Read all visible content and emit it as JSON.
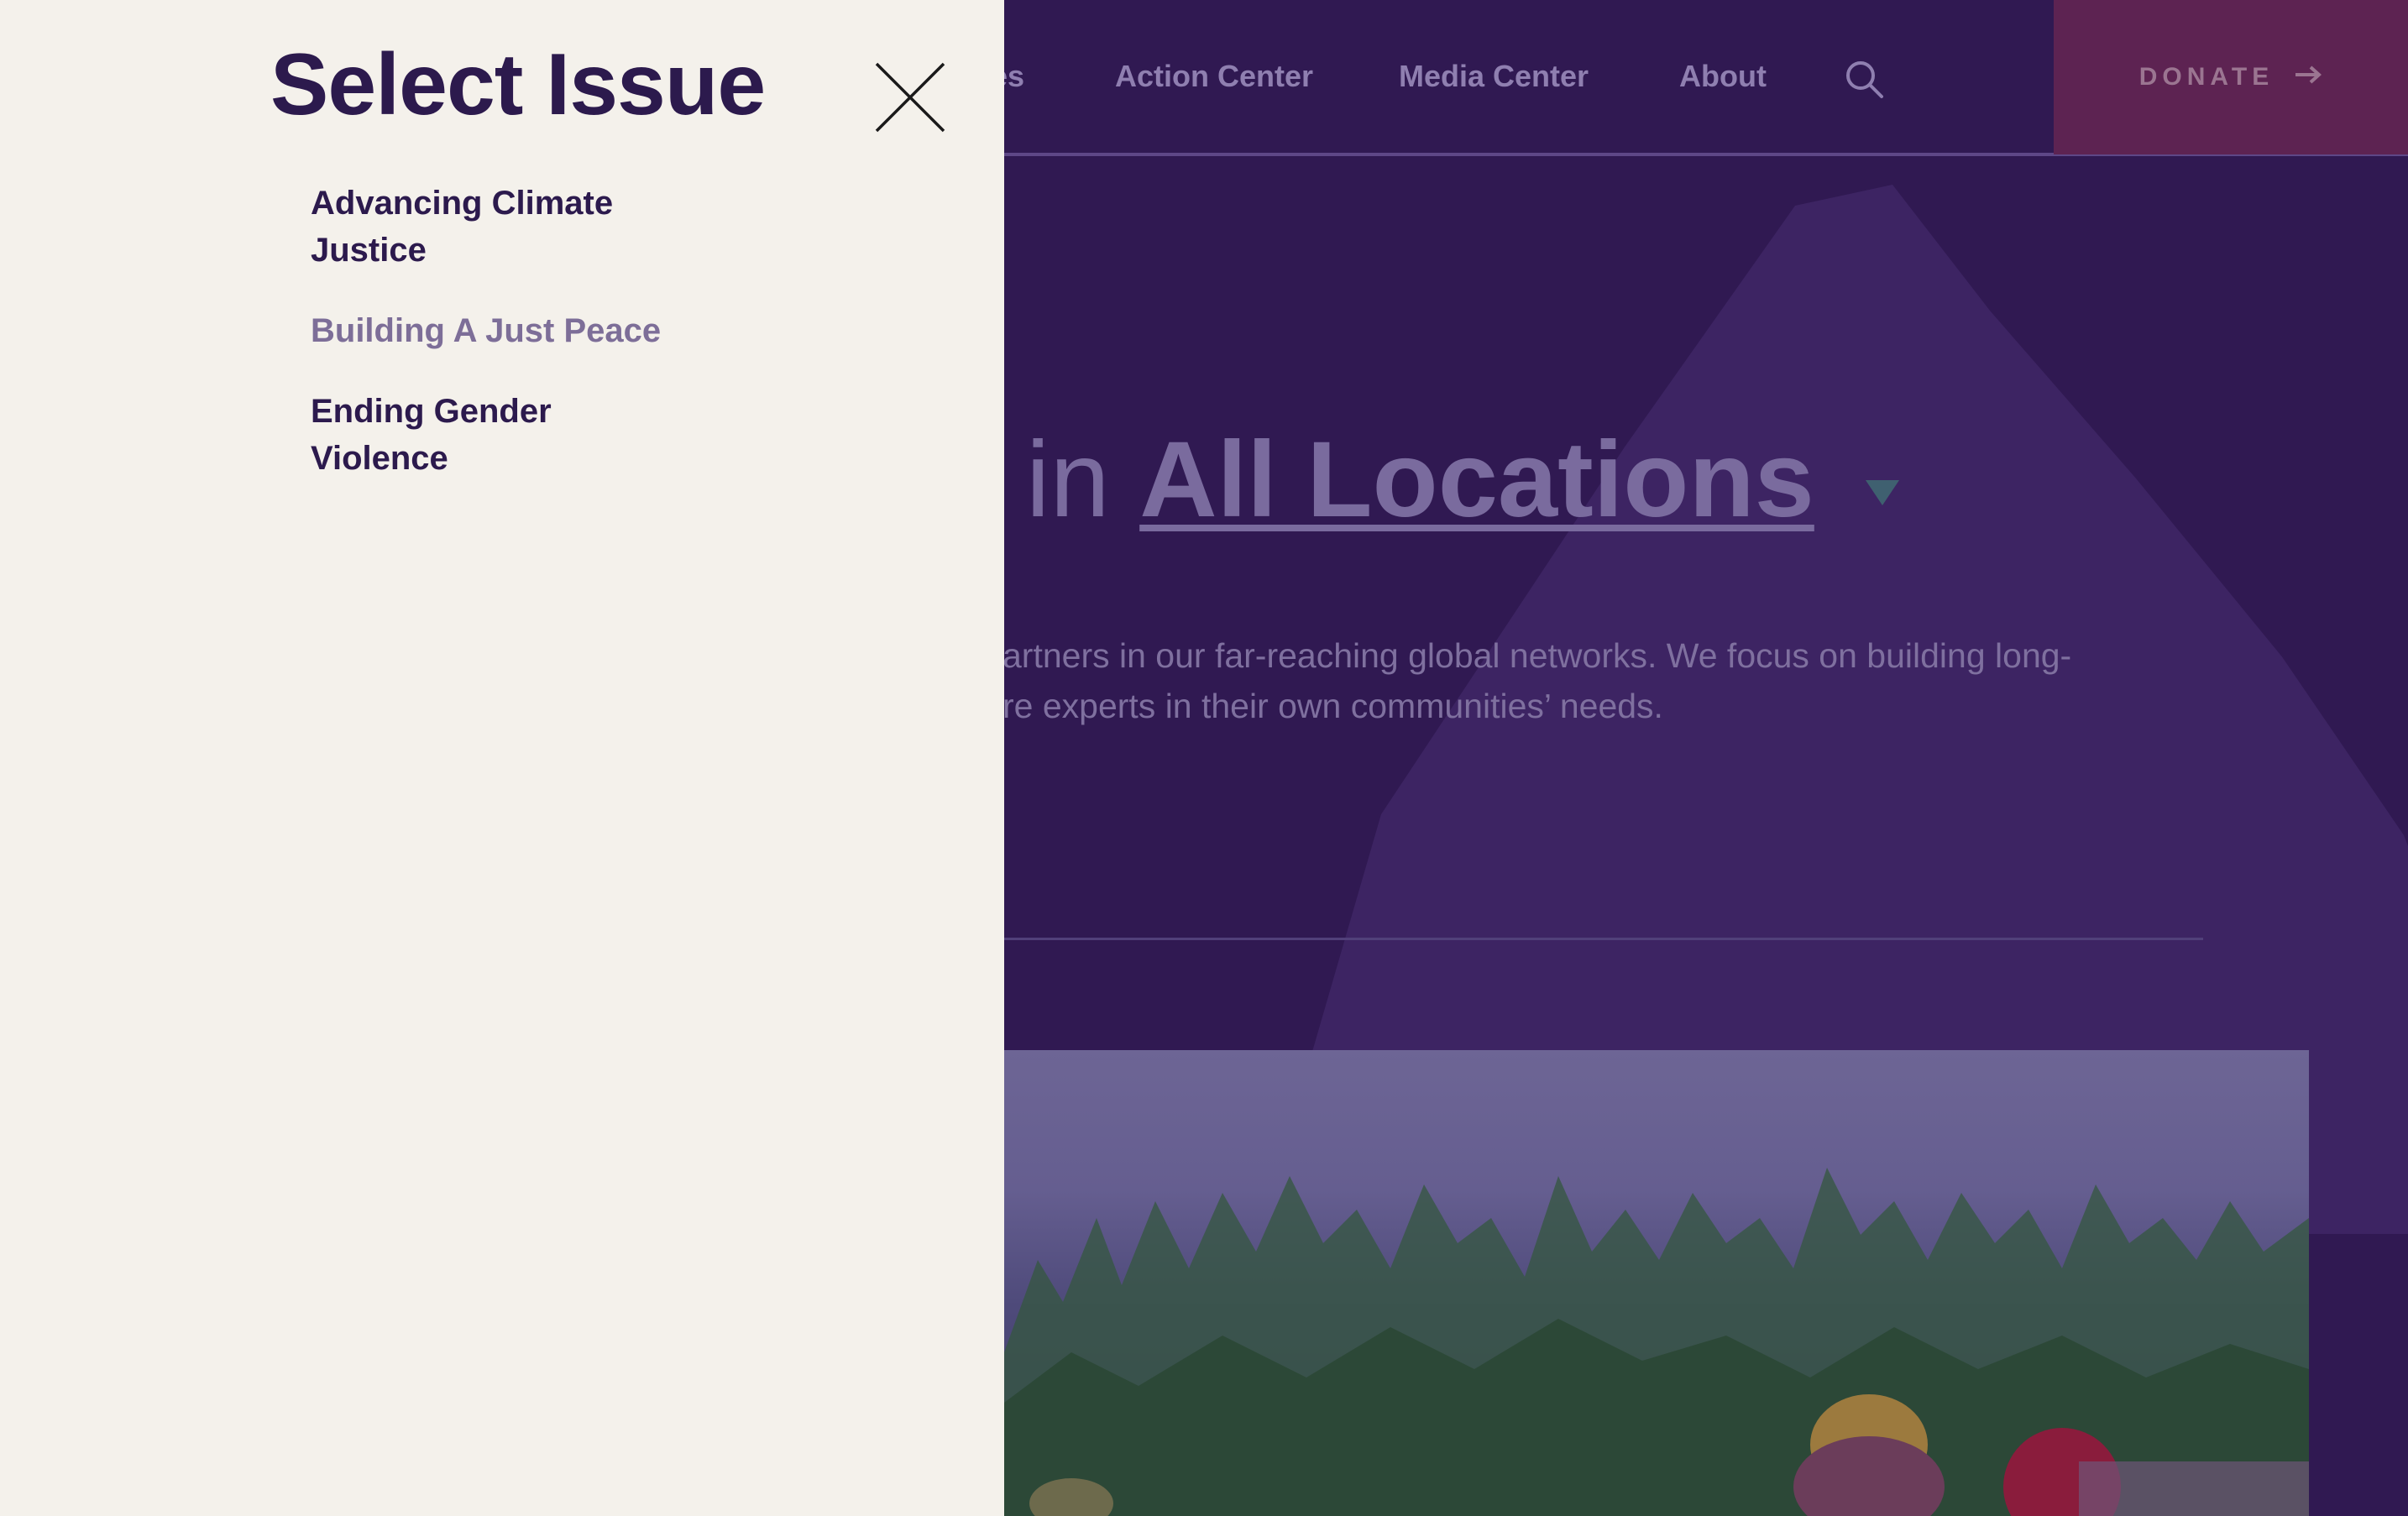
{
  "nav": {
    "partial_label": "es",
    "links": [
      "Action Center",
      "Media Center",
      "About"
    ],
    "search_icon": "search-icon",
    "donate_label": "DONATE",
    "donate_icon": "arrow-right-icon"
  },
  "hero": {
    "headline_prefix": "in",
    "location_label": "All Locations",
    "location_caret_icon": "caret-down-icon",
    "description_line_1": "artners in our far-reaching global networks. We focus on building long-",
    "description_line_2": "re experts in their own communities’ needs."
  },
  "drawer": {
    "title": "Select Issue",
    "close_icon": "close-icon",
    "issues": [
      {
        "label_line_1": "Advancing Climate",
        "label_line_2": "Justice",
        "selected": false
      },
      {
        "label_line_1": "Building A Just Peace",
        "label_line_2": "",
        "selected": true
      },
      {
        "label_line_1": "Ending Gender",
        "label_line_2": "Violence",
        "selected": false
      }
    ]
  },
  "colors": {
    "page_bg": "#301952",
    "drawer_bg": "#f4f1eb",
    "drawer_text": "#2c1a4d",
    "selected_issue": "#7d6e98",
    "donate_bg": "#5d2352"
  }
}
